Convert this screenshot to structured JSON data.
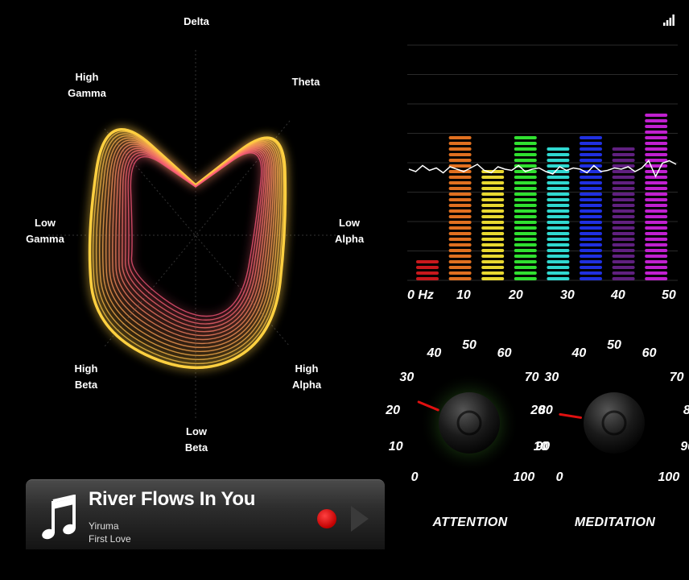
{
  "radar": {
    "labels": {
      "delta": [
        "Delta"
      ],
      "theta": [
        "Theta"
      ],
      "low_alpha": [
        "Low",
        "Alpha"
      ],
      "high_alpha": [
        "High",
        "Alpha"
      ],
      "low_beta": [
        "Low",
        "Beta"
      ],
      "high_beta": [
        "High",
        "Beta"
      ],
      "low_gamma": [
        "Low",
        "Gamma"
      ],
      "high_gamma": [
        "High",
        "Gamma"
      ]
    }
  },
  "spectrum": {
    "hz_ticks": [
      "0 Hz",
      "10",
      "20",
      "30",
      "40",
      "50"
    ],
    "bars": [
      {
        "color": "#c8181c",
        "level": 0.1
      },
      {
        "color": "#e07020",
        "level": 0.6
      },
      {
        "color": "#e8d830",
        "level": 0.47
      },
      {
        "color": "#30e030",
        "level": 0.6
      },
      {
        "color": "#30d8d0",
        "level": 0.57
      },
      {
        "color": "#2030e0",
        "level": 0.6
      },
      {
        "color": "#602080",
        "level": 0.57
      },
      {
        "color": "#c020d0",
        "level": 0.7
      }
    ]
  },
  "dials": {
    "scale": [
      "0",
      "10",
      "20",
      "30",
      "40",
      "50",
      "60",
      "70",
      "80",
      "90",
      "100"
    ],
    "attention": {
      "title": "ATTENTION",
      "value": 25
    },
    "meditation": {
      "title": "MEDITATION",
      "value": 20
    }
  },
  "player": {
    "title": "River Flows In You",
    "artist": "Yiruma",
    "album": "First Love",
    "icon": "music-note-icon"
  },
  "status": {
    "icon": "signal-strength-icon"
  },
  "colors": {
    "record": "#e00000",
    "radar_warm": "#ffd040",
    "radar_pink": "#ff6080"
  }
}
